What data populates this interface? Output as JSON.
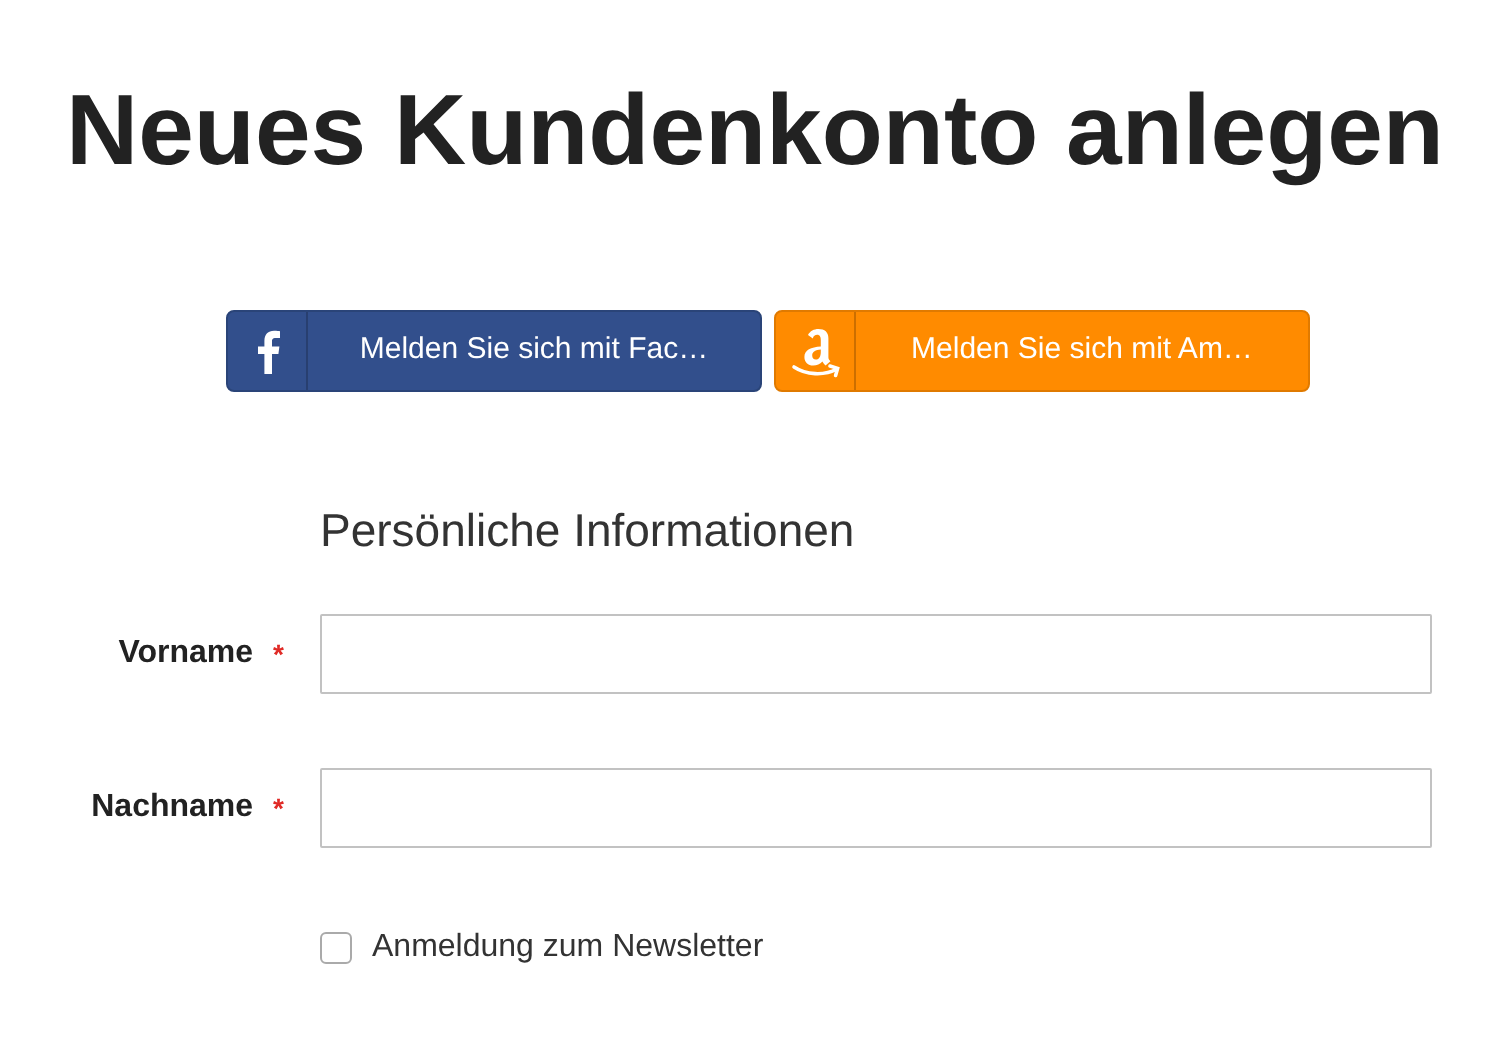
{
  "title": "Neues Kundenkonto anlegen",
  "social_buttons": [
    {
      "kind": "facebook",
      "label": "Melden Sie sich mit Fac…"
    },
    {
      "kind": "amazon",
      "label": "Melden Sie sich mit Am…"
    }
  ],
  "section_title": "Persönliche Informationen",
  "fields": [
    {
      "label": "Vorname",
      "required_mark": "*"
    },
    {
      "label": "Nachname",
      "required_mark": "*"
    }
  ],
  "newsletter": {
    "label": "Anmeldung zum Newsletter",
    "checked": false
  }
}
